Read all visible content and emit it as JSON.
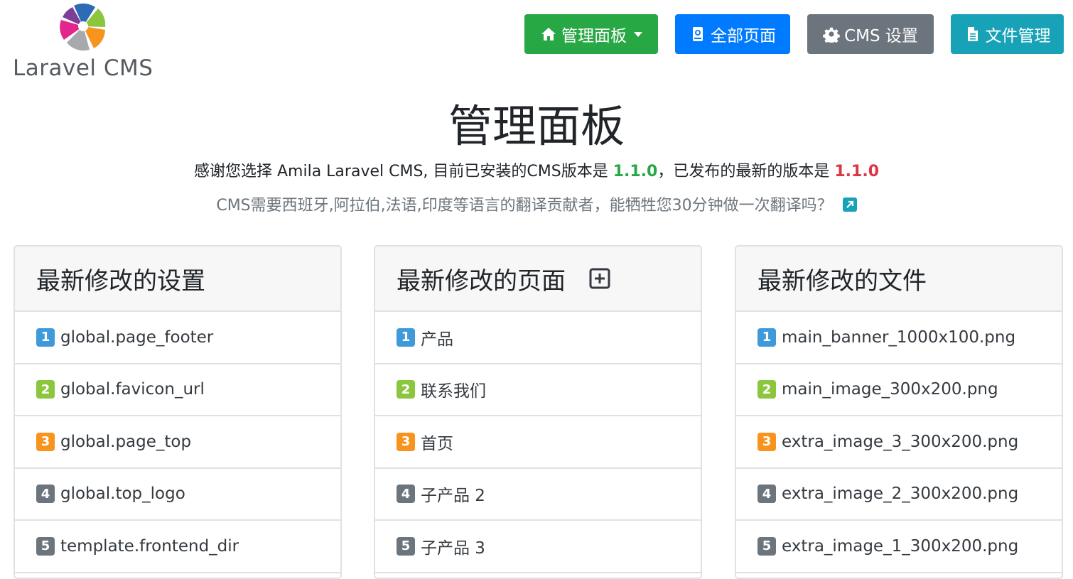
{
  "logo": {
    "text": "Laravel CMS"
  },
  "nav": {
    "dashboard": "管理面板",
    "all_pages": "全部页面",
    "cms_settings": "CMS 设置",
    "file_manager": "文件管理"
  },
  "hero": {
    "title": "管理面板",
    "version_prefix": "感谢您选择 Amila Laravel CMS, 目前已安装的CMS版本是",
    "installed_version": "1.1.0",
    "version_middle": "，已发布的最新的版本是",
    "latest_version": "1.1.0",
    "translate_text": "CMS需要西班牙,阿拉伯,法语,印度等语言的翻译贡献者，能牺牲您30分钟做一次翻译吗？"
  },
  "cards": {
    "settings": {
      "title": "最新修改的设置",
      "items": [
        {
          "num": "1",
          "label": "global.page_footer"
        },
        {
          "num": "2",
          "label": "global.favicon_url"
        },
        {
          "num": "3",
          "label": "global.page_top"
        },
        {
          "num": "4",
          "label": "global.top_logo"
        },
        {
          "num": "5",
          "label": "template.frontend_dir"
        }
      ]
    },
    "pages": {
      "title": "最新修改的页面",
      "items": [
        {
          "num": "1",
          "label": "产品"
        },
        {
          "num": "2",
          "label": "联系我们"
        },
        {
          "num": "3",
          "label": "首页"
        },
        {
          "num": "4",
          "label": "子产品 2"
        },
        {
          "num": "5",
          "label": "子产品 3"
        }
      ]
    },
    "files": {
      "title": "最新修改的文件",
      "items": [
        {
          "num": "1",
          "label": "main_banner_1000x100.png"
        },
        {
          "num": "2",
          "label": "main_image_300x200.png"
        },
        {
          "num": "3",
          "label": "extra_image_3_300x200.png"
        },
        {
          "num": "4",
          "label": "extra_image_2_300x200.png"
        },
        {
          "num": "5",
          "label": "extra_image_1_300x200.png"
        }
      ]
    }
  },
  "icons": {
    "dashboard": "home-icon",
    "all_pages": "book-icon",
    "cms_settings": "gear-icon",
    "file_manager": "file-icon",
    "translate_link": "external-link-icon",
    "add_page": "plus-square-icon"
  },
  "colors": {
    "success": "#28a745",
    "primary": "#007bff",
    "secondary": "#6c757d",
    "info": "#17a2b8",
    "danger": "#dc3545",
    "badge_1": "#3e9ad9",
    "badge_2": "#8cc63e",
    "badge_3": "#f7941d",
    "badge_4": "#6c757d",
    "badge_5": "#6c757d"
  }
}
